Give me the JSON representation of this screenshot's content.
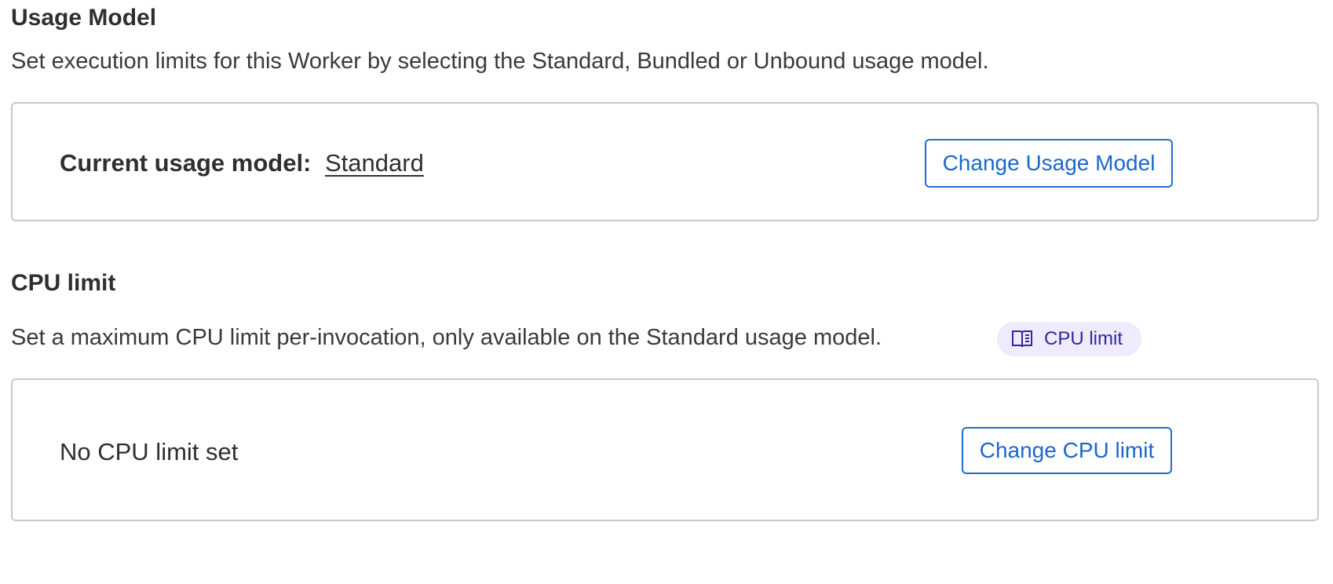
{
  "usage_model": {
    "heading": "Usage Model",
    "description": "Set execution limits for this Worker by selecting the Standard, Bundled or Unbound usage model.",
    "current_label": "Current usage model:",
    "current_value": "Standard",
    "button_label": "Change Usage Model"
  },
  "cpu_limit": {
    "heading": "CPU limit",
    "description": "Set a maximum CPU limit per-invocation, only available on the Standard usage model.",
    "docs_pill": {
      "icon": "book-icon",
      "label": "CPU limit"
    },
    "status": "No CPU limit set",
    "button_label": "Change CPU limit"
  },
  "colors": {
    "accent": "#1f6fd1",
    "border": "#c9c9c9",
    "pill_bg": "#efeafc",
    "pill_text": "#2e2a9a"
  }
}
